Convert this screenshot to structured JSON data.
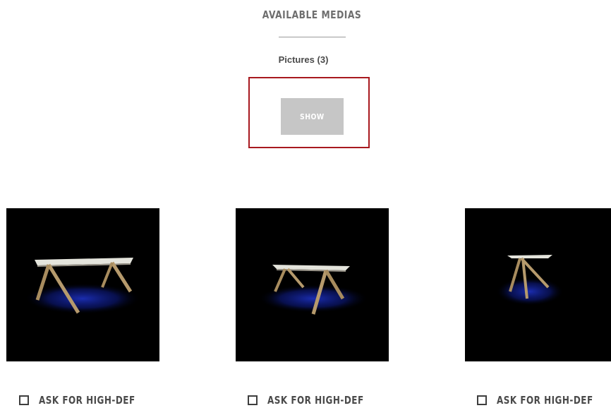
{
  "section": {
    "title": "AVAILABLE MEDIAS",
    "pictures_label": "Pictures (3)",
    "show_label": "SHOW"
  },
  "colors": {
    "highlight_border": "#a8191f",
    "button_bg": "#c6c6c6",
    "thumb_bg": "#000000",
    "title_text": "#6e6e6e"
  },
  "media": [
    {
      "checkbox_label": "ASK FOR HIGH-DEF",
      "checked": false,
      "image": "table-photo-icon"
    },
    {
      "checkbox_label": "ASK FOR HIGH-DEF",
      "checked": false,
      "image": "table-photo-icon"
    },
    {
      "checkbox_label": "ASK FOR HIGH-DEF",
      "checked": false,
      "image": "table-photo-icon"
    }
  ]
}
